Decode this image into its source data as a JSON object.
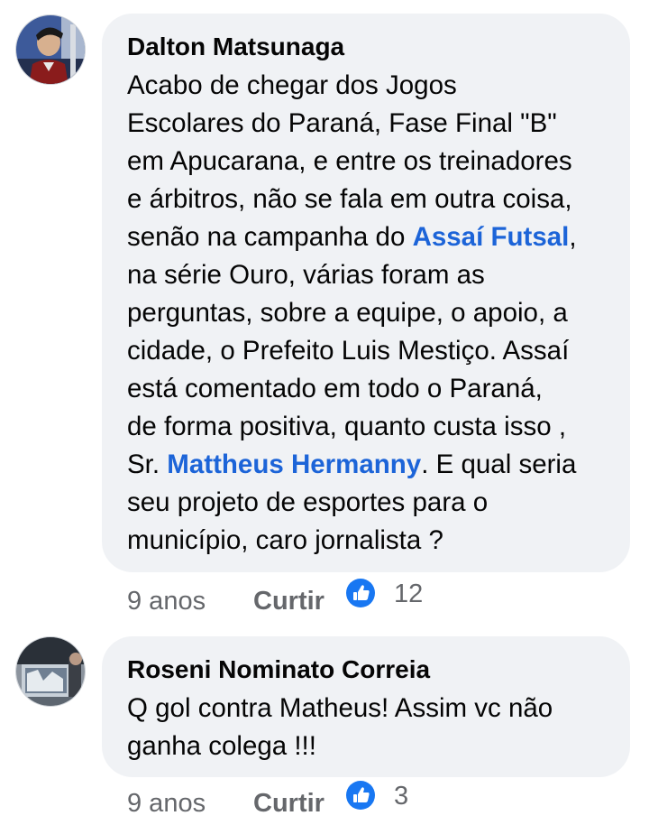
{
  "comments": [
    {
      "author": "Dalton Matsunaga",
      "lines": [
        [
          "Acabo de chegar dos Jogos"
        ],
        [
          "Escolares do Paraná, Fase Final \"B\""
        ],
        [
          "em Apucarana, e entre os treinadores"
        ],
        [
          "e árbitros, não se fala em outra coisa,"
        ],
        [
          "senão na campanha do ",
          "Assaí Futsal",
          ","
        ],
        [
          "na série Ouro, várias foram as"
        ],
        [
          "perguntas, sobre a equipe, o apoio, a"
        ],
        [
          "cidade, o Prefeito Luis Mestiço. Assaí"
        ],
        [
          "está comentado em todo o Paraná,"
        ],
        [
          "de forma positiva, quanto custa isso ,"
        ],
        [
          "Sr. ",
          "Mattheus Hermanny",
          ". E qual seria"
        ],
        [
          "seu projeto de esportes para o"
        ],
        [
          "município, caro jornalista ?"
        ]
      ],
      "time": "9 anos",
      "like_label": "Curtir",
      "like_count": "12"
    },
    {
      "author": "Roseni Nominato Correia",
      "lines": [
        [
          "Q gol contra  Matheus!  Assim vc não"
        ],
        [
          "ganha colega !!!"
        ]
      ],
      "time": "9 anos",
      "like_label": "Curtir",
      "like_count": "3"
    }
  ],
  "colors": {
    "bubble": "#f0f2f5",
    "mention": "#1c64d8",
    "meta": "#65676b",
    "like_icon": "#1877f2"
  },
  "icons": [
    "avatar",
    "like-icon"
  ]
}
